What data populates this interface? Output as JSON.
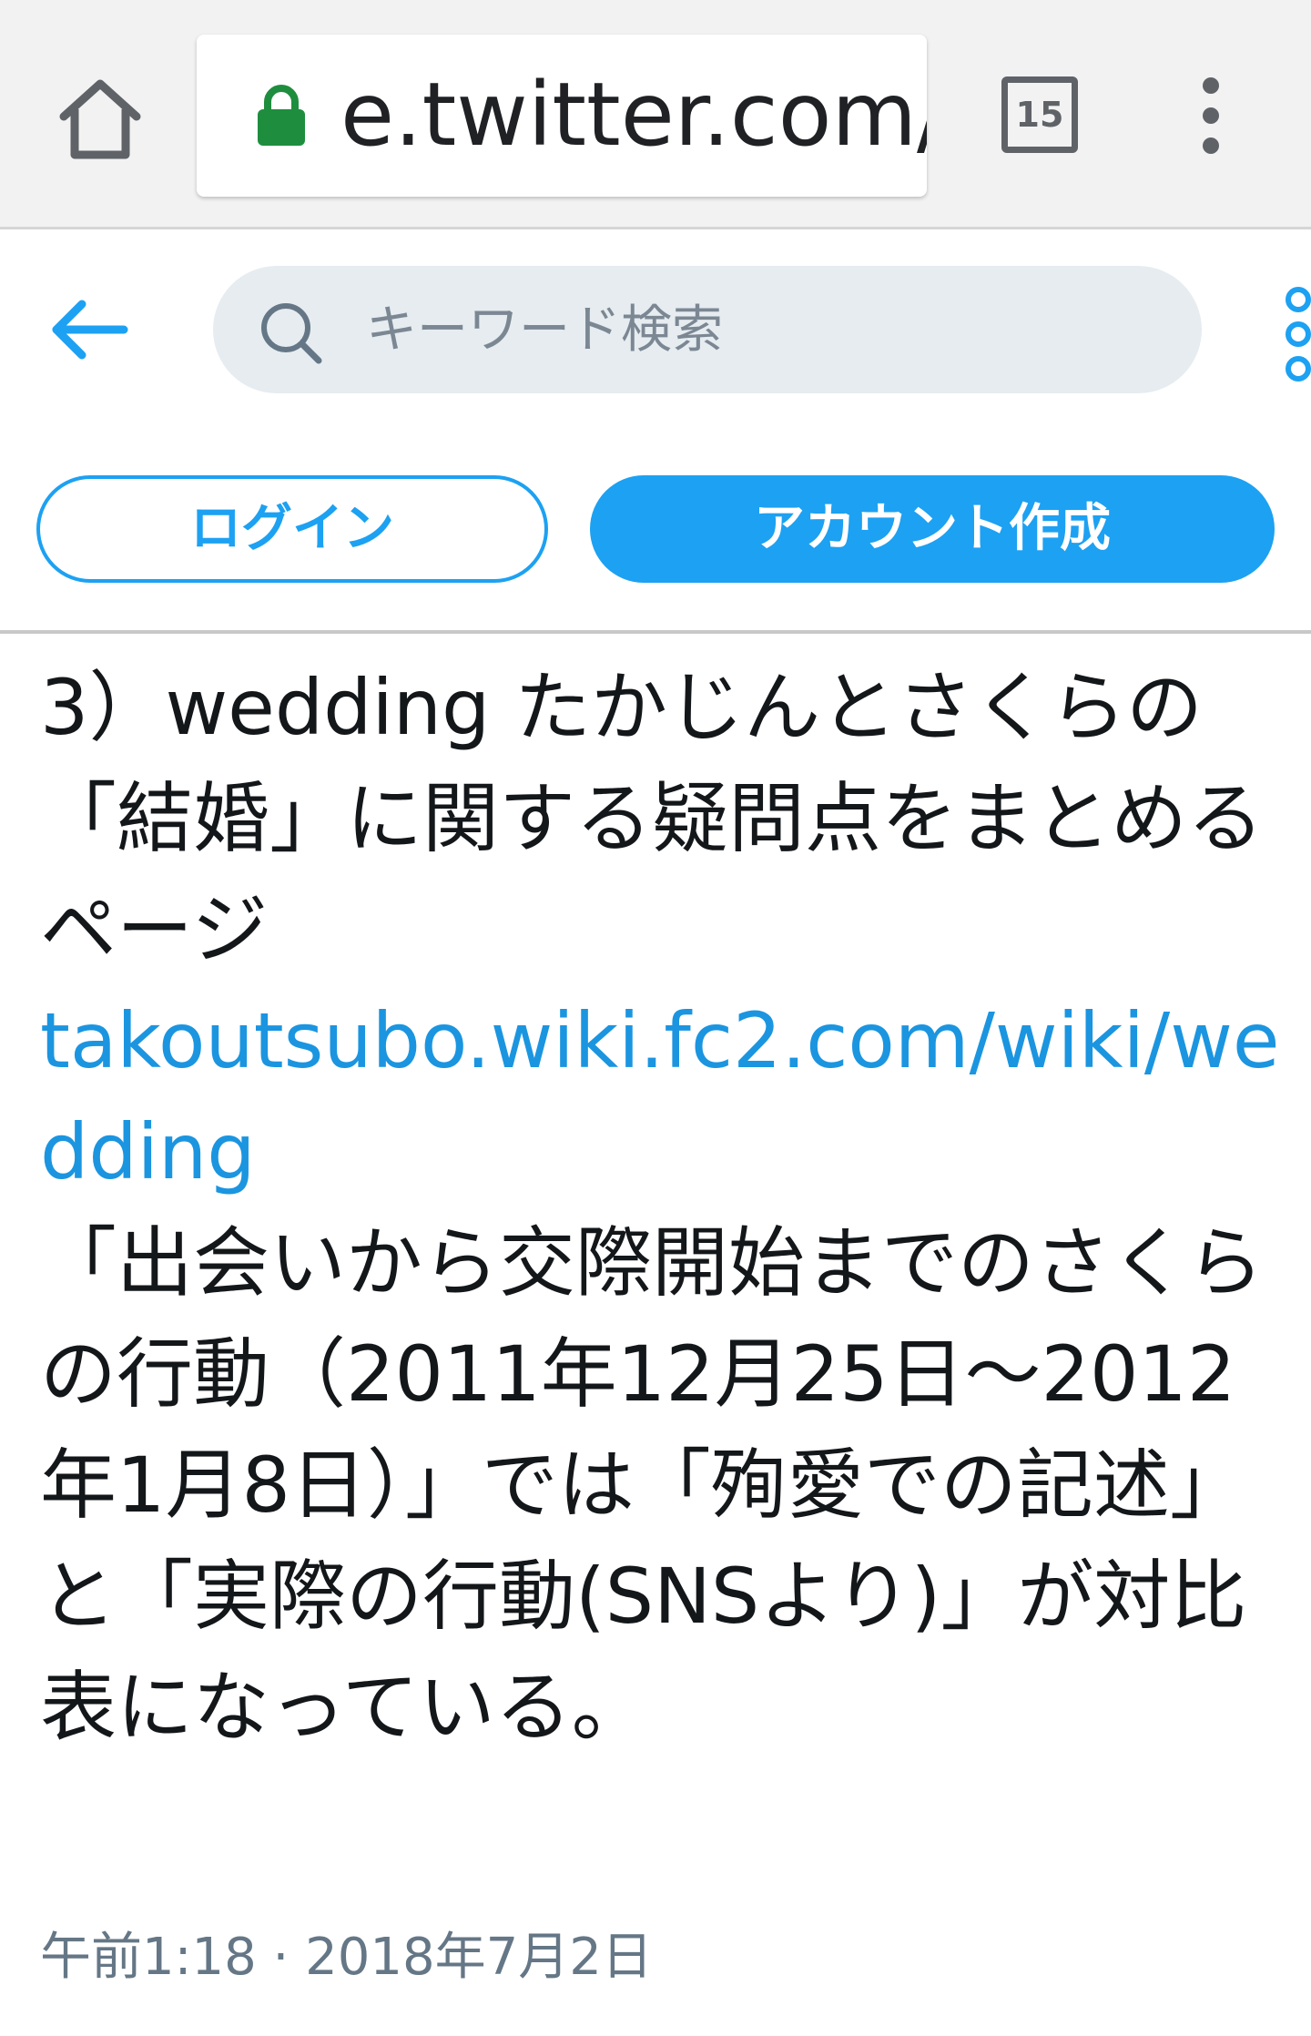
{
  "browser": {
    "url_visible": "e.twitter.com/",
    "url_faded": "t",
    "tab_count": "15",
    "icons": {
      "home": "home-icon",
      "lock": "lock-icon",
      "tabs": "tab-switcher-icon",
      "menu": "more-vert-icon"
    },
    "colors": {
      "lock": "#1e8e3e",
      "chrome_bg": "#f2f2f2"
    }
  },
  "header": {
    "search_placeholder": "キーワード検索",
    "login_label": "ログイン",
    "signup_label": "アカウント作成",
    "icons": {
      "back": "back-arrow-icon",
      "search": "search-icon",
      "more": "more-vert-icon"
    },
    "colors": {
      "accent": "#1da1f2",
      "search_bg": "#e6ecf0"
    }
  },
  "tweet": {
    "text_intro": "3）wedding たかじんとさくらの「結婚」に関する疑問点をまとめるページ",
    "link": "takoutsubo.wiki.fc2.com/wiki/wedding",
    "text_body": "「出会いから交際開始までのさくらの行動（2011年12月25日〜2012年1月8日）」では「殉愛での記述」と「実際の行動(SNSより)」が対比表になっている。",
    "timestamp": "午前1:18 · 2018年7月2日",
    "colors": {
      "link": "#1b95e0",
      "meta": "#657786"
    }
  }
}
